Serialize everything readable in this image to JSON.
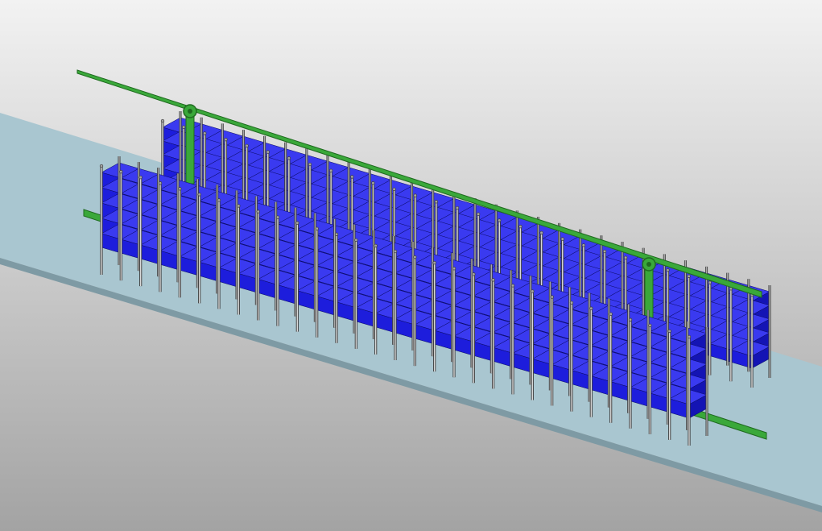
{
  "viewport": {
    "background_top": "#f2f2f2",
    "background_bottom": "#a3a3a3"
  },
  "scene": {
    "floor_color": "#a9c6d0",
    "floor_edge_color": "#7e9aa4",
    "bin_front_color": "#1d1ddc",
    "bin_top_color": "#3a3af0",
    "bin_side_color": "#1414b4",
    "post_color": "#a6a6a6",
    "post_edge_color": "#3c3c3c",
    "rail_color": "#3aa83a",
    "rail_dark_color": "#1f6a1f",
    "back_rack_columns": 28,
    "front_rack_columns": 30,
    "tiers": 5,
    "rail_trolleys": 2
  }
}
